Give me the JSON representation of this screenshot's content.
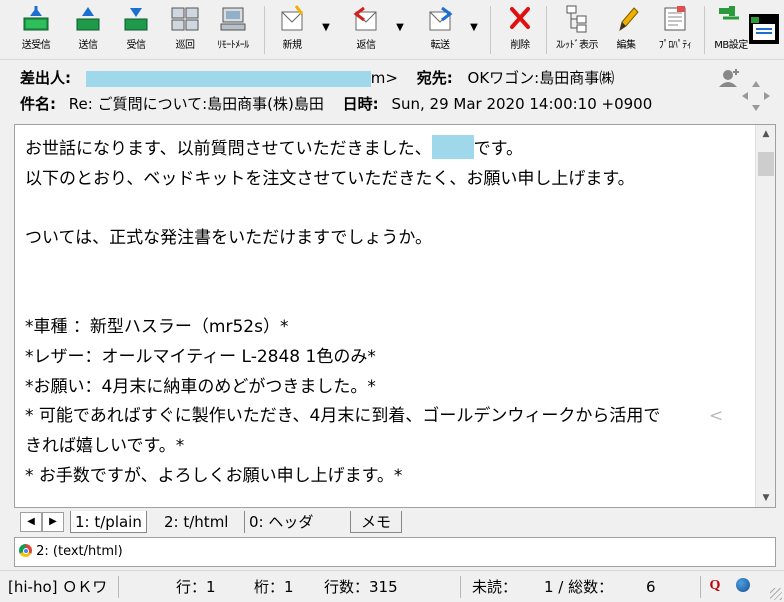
{
  "toolbar": {
    "buttons": [
      {
        "label": "送受信",
        "icon": "send-receive-icon"
      },
      {
        "label": "送信",
        "icon": "send-icon"
      },
      {
        "label": "受信",
        "icon": "receive-icon"
      },
      {
        "label": "巡回",
        "icon": "patrol-icon"
      },
      {
        "label": "ﾘﾓｰﾄﾒｰﾙ",
        "icon": "remote-mail-icon"
      },
      {
        "label": "新規",
        "icon": "new-mail-icon"
      },
      {
        "label": "返信",
        "icon": "reply-icon"
      },
      {
        "label": "転送",
        "icon": "forward-icon"
      },
      {
        "label": "削除",
        "icon": "delete-icon"
      },
      {
        "label": "ｽﾚｯﾄﾞ表示",
        "icon": "thread-view-icon"
      },
      {
        "label": "編集",
        "icon": "edit-icon"
      },
      {
        "label": "ﾌﾟﾛﾊﾟﾃｨ",
        "icon": "properties-icon"
      },
      {
        "label": "MB設定",
        "icon": "mailbox-settings-icon"
      }
    ]
  },
  "header": {
    "from_label": "差出人:",
    "from_tail": "m>",
    "to_label": "宛先:",
    "to_value": "OKワゴン:島田商事㈱",
    "subject_label": "件名:",
    "subject_value": "Re: ご質問について:島田商事(株)島田",
    "date_label": "日時:",
    "date_value": "Sun, 29 Mar 2020 14:00:10 +0900"
  },
  "body": {
    "lines": [
      {
        "before": "お世話になります、以前質問させていただきました、",
        "after": "です。"
      },
      {
        "text": "以下のとおり、ベッドキットを注文させていただきたく、お願い申し上げます。"
      },
      {
        "text": ""
      },
      {
        "text": "ついては、正式な発注書をいただけますでしょうか。"
      },
      {
        "text": ""
      },
      {
        "text": ""
      },
      {
        "text": "*車種 ：新型ハスラー（mr52s）*"
      },
      {
        "text": "*レザー：オールマイティー L-2848 1色のみ*"
      },
      {
        "text": "*お願い：4月末に納車のめどがつきました。*"
      },
      {
        "text": "* 可能であればすぐに製作いただき、4月末に到着、ゴールデンウィークから活用で"
      },
      {
        "text": "きれば嬉しいです。*"
      },
      {
        "text": "* お手数ですが、よろしくお願い申し上げます。*"
      }
    ],
    "wrap_marker": "<"
  },
  "tabs": [
    {
      "label": "1: t/plain"
    },
    {
      "label": "2: t/html"
    },
    {
      "label": "0: ヘッダ"
    },
    {
      "label": "メモ"
    }
  ],
  "attachment": {
    "label": "2: (text/html)"
  },
  "status": {
    "account": "[hi-ho] ＯＫワ",
    "line": "行：1",
    "col": "桁：1",
    "lines": "行数：315",
    "unread": "未読：",
    "total": "1 / 総数：",
    "total_count": "6"
  },
  "colors": {
    "redaction": "#9fd8ea",
    "delete_red": "#e01010",
    "accent_blue": "#1e6fd0"
  }
}
